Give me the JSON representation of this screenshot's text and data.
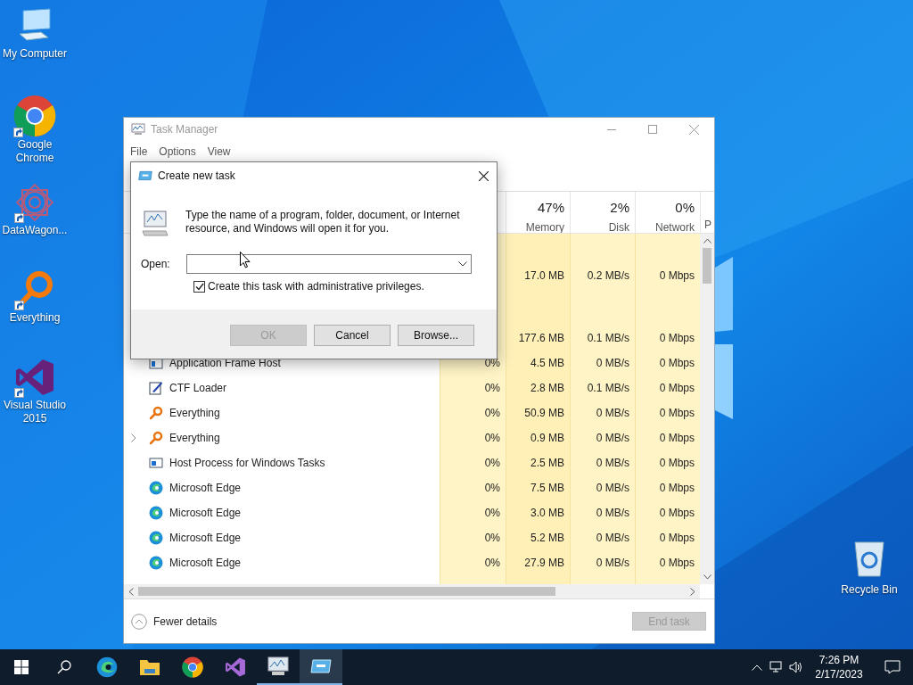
{
  "desktop_icons": [
    {
      "label": "My Computer",
      "kind": "computer",
      "shortcut": false
    },
    {
      "label": "Google Chrome",
      "kind": "chrome",
      "shortcut": true
    },
    {
      "label": "DataWagon...",
      "kind": "datawagon",
      "shortcut": true
    },
    {
      "label": "Everything",
      "kind": "everything",
      "shortcut": true
    },
    {
      "label": "Visual Studio 2015",
      "kind": "vs",
      "shortcut": true
    }
  ],
  "recycle_bin": {
    "label": "Recycle Bin"
  },
  "task_manager": {
    "title": "Task Manager",
    "menu": [
      "File",
      "Options",
      "View"
    ],
    "columns": [
      {
        "percent": "47%",
        "label": "Memory"
      },
      {
        "percent": "2%",
        "label": "Disk"
      },
      {
        "percent": "0%",
        "label": "Network"
      },
      {
        "label": "P"
      }
    ],
    "rows": [
      {
        "kind": "hidden",
        "memory": "17.0 MB",
        "disk": "0.2 MB/s",
        "network": "0 Mbps"
      },
      {
        "kind": "hidden",
        "memory": "177.6 MB",
        "disk": "0.1 MB/s",
        "network": "0 Mbps"
      },
      {
        "kind": "app",
        "name": "Application Frame Host",
        "expandable": false,
        "cpu": "0%",
        "memory": "4.5 MB",
        "disk": "0 MB/s",
        "network": "0 Mbps"
      },
      {
        "kind": "ctf",
        "name": "CTF Loader",
        "expandable": false,
        "cpu": "0%",
        "memory": "2.8 MB",
        "disk": "0.1 MB/s",
        "network": "0 Mbps"
      },
      {
        "kind": "everything",
        "name": "Everything",
        "expandable": false,
        "cpu": "0%",
        "memory": "50.9 MB",
        "disk": "0 MB/s",
        "network": "0 Mbps"
      },
      {
        "kind": "everything",
        "name": "Everything",
        "expandable": true,
        "cpu": "0%",
        "memory": "0.9 MB",
        "disk": "0 MB/s",
        "network": "0 Mbps"
      },
      {
        "kind": "host",
        "name": "Host Process for Windows Tasks",
        "expandable": false,
        "cpu": "0%",
        "memory": "2.5 MB",
        "disk": "0 MB/s",
        "network": "0 Mbps"
      },
      {
        "kind": "edge",
        "name": "Microsoft Edge",
        "expandable": false,
        "cpu": "0%",
        "memory": "7.5 MB",
        "disk": "0 MB/s",
        "network": "0 Mbps"
      },
      {
        "kind": "edge",
        "name": "Microsoft Edge",
        "expandable": false,
        "cpu": "0%",
        "memory": "3.0 MB",
        "disk": "0 MB/s",
        "network": "0 Mbps"
      },
      {
        "kind": "edge",
        "name": "Microsoft Edge",
        "expandable": false,
        "cpu": "0%",
        "memory": "5.2 MB",
        "disk": "0 MB/s",
        "network": "0 Mbps"
      },
      {
        "kind": "edge",
        "name": "Microsoft Edge",
        "expandable": false,
        "cpu": "0%",
        "memory": "27.9 MB",
        "disk": "0 MB/s",
        "network": "0 Mbps"
      }
    ],
    "fewer_details": "Fewer details",
    "end_task": {
      "label": "End task",
      "disabled": true
    }
  },
  "dialog": {
    "title": "Create new task",
    "message": "Type the name of a program, folder, document, or Internet resource, and Windows will open it for you.",
    "open_label": "Open:",
    "admin_checkbox": {
      "label": "Create this task with administrative privileges.",
      "checked": true
    },
    "buttons": [
      {
        "label": "OK",
        "disabled": true
      },
      {
        "label": "Cancel",
        "disabled": false
      },
      {
        "label": "Browse...",
        "disabled": false
      }
    ]
  },
  "taskbar": {
    "apps": [
      {
        "kind": "edge",
        "running": false,
        "active": false
      },
      {
        "kind": "folder",
        "running": false,
        "active": false
      },
      {
        "kind": "chrome",
        "running": false,
        "active": false
      },
      {
        "kind": "vs",
        "running": false,
        "active": false
      },
      {
        "kind": "taskmgr",
        "running": true,
        "active": false
      },
      {
        "kind": "run",
        "running": true,
        "active": true
      }
    ],
    "time": "7:26 PM",
    "date": "2/17/2023"
  }
}
